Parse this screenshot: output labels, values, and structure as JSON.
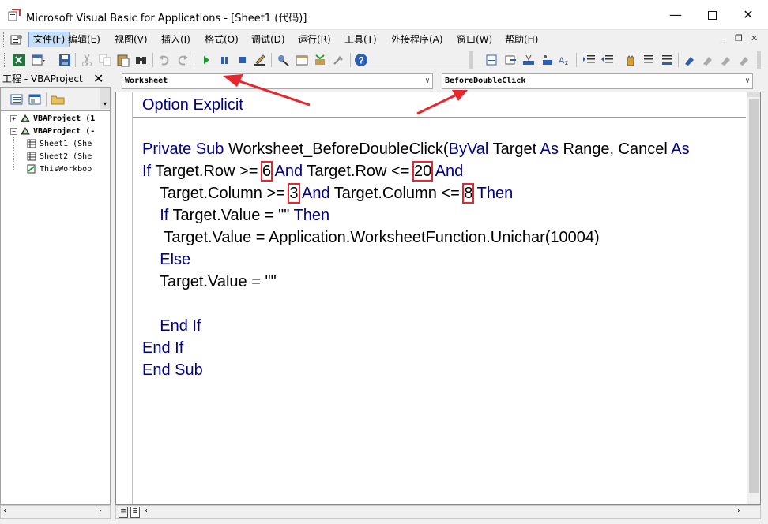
{
  "window": {
    "title": "Microsoft Visual Basic for Applications - [Sheet1 (代码)]",
    "minimize_glyph": "—",
    "close_glyph": "✕"
  },
  "menu": {
    "items": [
      {
        "label": "文件(F)",
        "active": true
      },
      {
        "label": "编辑(E)"
      },
      {
        "label": "视图(V)"
      },
      {
        "label": "插入(I)"
      },
      {
        "label": "格式(O)"
      },
      {
        "label": "调试(D)"
      },
      {
        "label": "运行(R)"
      },
      {
        "label": "工具(T)"
      },
      {
        "label": "外接程序(A)"
      },
      {
        "label": "窗口(W)"
      },
      {
        "label": "帮助(H)"
      }
    ],
    "mdi_controls": [
      "_",
      "❐",
      "✕"
    ]
  },
  "toolbar": {
    "icons": [
      "excel-icon",
      "insert-userform-icon",
      "save-icon",
      "cut-icon",
      "copy-icon",
      "paste-icon",
      "find-icon",
      "undo-icon",
      "redo-icon",
      "run-icon",
      "break-icon",
      "reset-icon",
      "design-mode-icon",
      "project-explorer-icon",
      "properties-icon",
      "object-browser-icon",
      "toolbox-icon",
      "help-icon"
    ]
  },
  "project_pane": {
    "title": "工程 - VBAProject",
    "close_glyph": "✕",
    "tree": [
      {
        "label": "VBAProject (1",
        "level": 0,
        "expand": "+"
      },
      {
        "label": "VBAProject (-",
        "level": 0,
        "expand": "−"
      },
      {
        "label": "Sheet1 (She",
        "level": 1
      },
      {
        "label": "Sheet2 (She",
        "level": 1
      },
      {
        "label": "ThisWorkboo",
        "level": 1
      }
    ]
  },
  "code_window": {
    "object_combo": "Worksheet",
    "procedure_combo": "BeforeDoubleClick",
    "lines": [
      [
        {
          "t": "Option Explicit",
          "k": 1
        }
      ],
      [],
      [
        {
          "t": "Private Sub ",
          "k": 1
        },
        {
          "t": "Worksheet_BeforeDoubleClick("
        },
        {
          "t": "ByVal",
          "k": 1
        },
        {
          "t": " Target "
        },
        {
          "t": "As",
          "k": 1
        },
        {
          "t": " Range, Cancel "
        },
        {
          "t": "As",
          "k": 1
        }
      ],
      [
        {
          "t": "If",
          "k": 1
        },
        {
          "t": " Target.Row >= "
        },
        {
          "t": "6",
          "h": 1
        },
        {
          "t": " "
        },
        {
          "t": "And",
          "k": 1
        },
        {
          "t": " Target.Row <= "
        },
        {
          "t": "20",
          "h": 1
        },
        {
          "t": " "
        },
        {
          "t": "And",
          "k": 1
        }
      ],
      [
        {
          "t": "    Target.Column >= "
        },
        {
          "t": "3",
          "h": 1
        },
        {
          "t": " "
        },
        {
          "t": "And",
          "k": 1
        },
        {
          "t": " Target.Column <= "
        },
        {
          "t": "8",
          "h": 1
        },
        {
          "t": " "
        },
        {
          "t": "Then",
          "k": 1
        }
      ],
      [
        {
          "t": "    "
        },
        {
          "t": "If",
          "k": 1
        },
        {
          "t": " Target.Value = \"\" "
        },
        {
          "t": "Then",
          "k": 1
        }
      ],
      [
        {
          "t": "     Target.Value = Application.WorksheetFunction.Unichar(10004)"
        }
      ],
      [
        {
          "t": "    "
        },
        {
          "t": "Else",
          "k": 1
        }
      ],
      [
        {
          "t": "    Target.Value = \"\""
        }
      ],
      [],
      [
        {
          "t": "    "
        },
        {
          "t": "End If",
          "k": 1
        }
      ],
      [
        {
          "t": "End If",
          "k": 1
        }
      ],
      [
        {
          "t": "End Sub",
          "k": 1
        }
      ]
    ]
  },
  "colors": {
    "keyword": "#00008b",
    "highlight_box": "#e8262d",
    "annotation_arrow": "#e8262d",
    "menu_active_bg": "#c6dff6"
  }
}
